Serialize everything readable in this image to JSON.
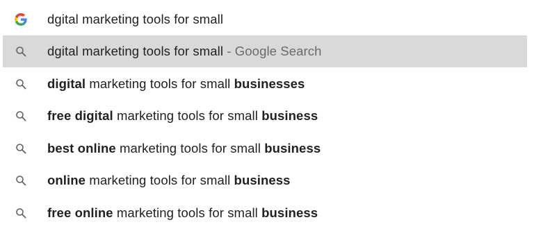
{
  "input_row": {
    "icon": "google-g-icon",
    "text": "dgital marketing tools for small"
  },
  "highlighted_row": {
    "icon": "search-icon",
    "query": "dgital marketing tools for small",
    "suffix": " - Google Search"
  },
  "suggestions": [
    {
      "icon": "search-icon",
      "parts": [
        "digital",
        " marketing tools for small ",
        "businesses"
      ]
    },
    {
      "icon": "search-icon",
      "parts": [
        "free digital",
        " marketing tools for small ",
        "business"
      ]
    },
    {
      "icon": "search-icon",
      "parts": [
        "best online",
        " marketing tools for small ",
        "business"
      ]
    },
    {
      "icon": "search-icon",
      "parts": [
        "online",
        " marketing tools for small ",
        "business"
      ]
    },
    {
      "icon": "search-icon",
      "parts": [
        "free online",
        " marketing tools for small ",
        "business"
      ]
    }
  ],
  "colors": {
    "highlight": "#d9d9d9",
    "text": "#202124",
    "suffix": "#6a6a6a",
    "g_blue": "#4285F4",
    "g_red": "#EA4335",
    "g_yellow": "#FBBC05",
    "g_green": "#34A853"
  }
}
